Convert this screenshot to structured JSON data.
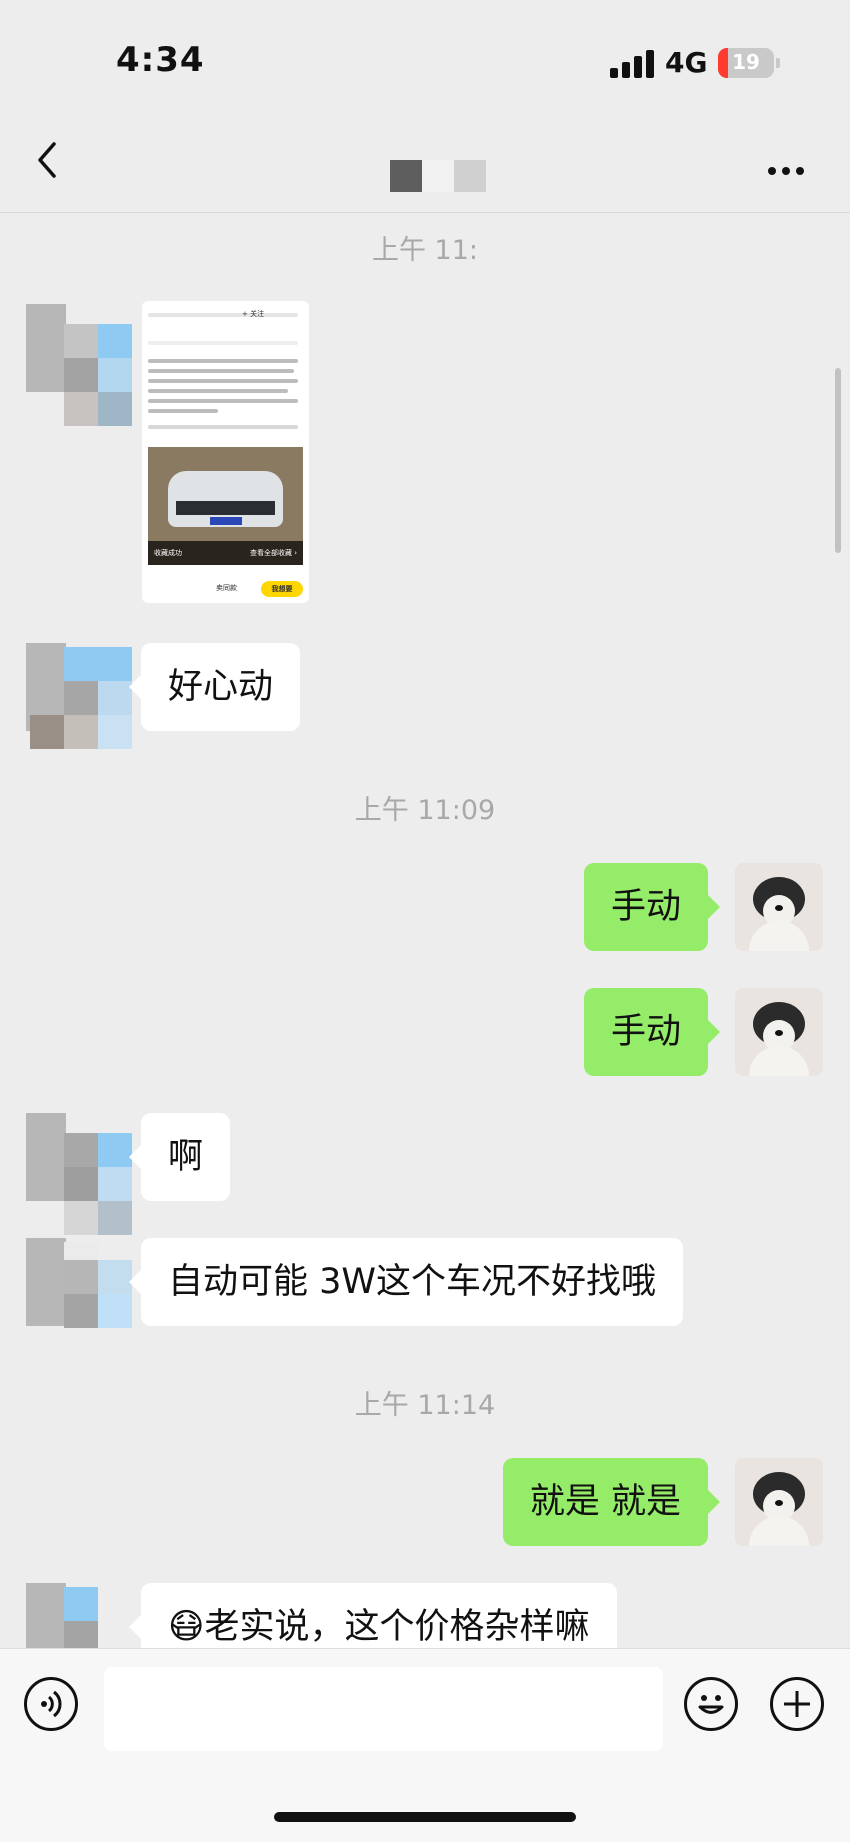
{
  "status_bar": {
    "time": "4:34",
    "network": "4G",
    "battery": "19"
  },
  "nav": {
    "title": ""
  },
  "messages": {
    "ts1": "上午 11:",
    "ts2": "上午 11:09",
    "ts3": "上午 11:14",
    "m_in_1": "好心动",
    "m_out_1": "手动",
    "m_out_2": "手动",
    "m_in_2": "啊",
    "m_in_3": "自动可能 3W这个车况不好找哦",
    "m_out_3": "就是 就是",
    "m_in_4": "老实说，这个价格杂样嘛",
    "m_in_4_emoji": "😷"
  },
  "shared_image": {
    "follow": "+ 关注",
    "want_button": "我想要",
    "wish_button": "卖同款",
    "collect_toast": "收藏成功",
    "view_favorites": "查看全部收藏 ›"
  },
  "colors": {
    "background": "#ededed",
    "bubble_out": "#95ec69",
    "bubble_in": "#ffffff",
    "battery_low": "#ff3b30"
  },
  "icons": {
    "back": "chevron-left-icon",
    "more": "more-dots-icon",
    "voice": "voice-icon",
    "emoji": "emoji-icon",
    "plus": "plus-icon"
  }
}
